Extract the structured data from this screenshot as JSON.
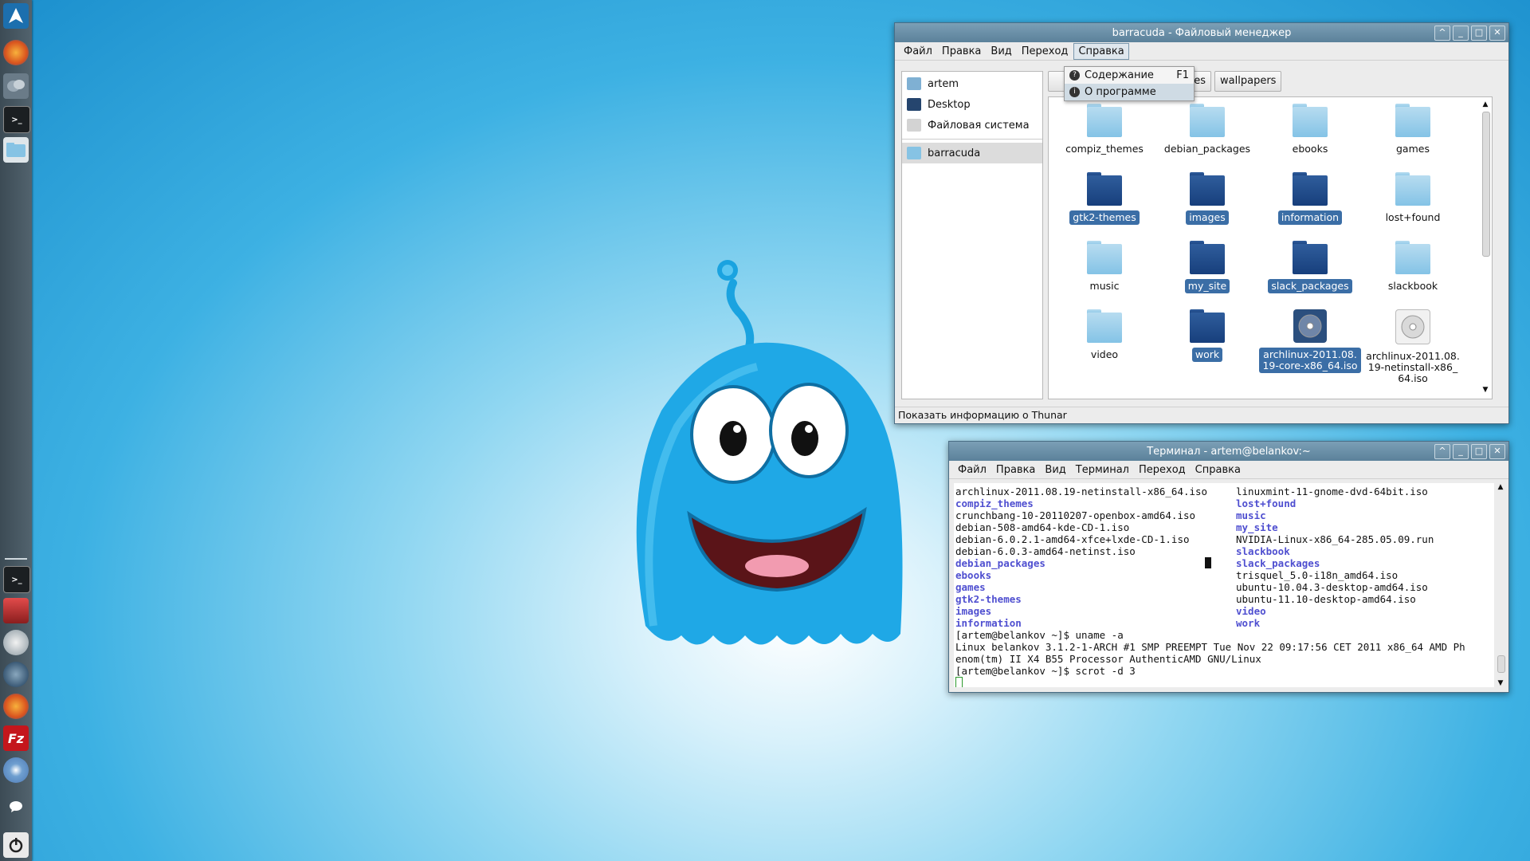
{
  "desktop": {
    "dock_items": [
      "arch-logo-icon",
      "firefox-icon",
      "pidgin-icon",
      "terminal-icon",
      "file-manager-icon",
      "terminal-icon-2",
      "image-viewer-icon",
      "disk-icon",
      "media-player-icon",
      "firefox-icon-2",
      "filezilla-icon",
      "chromium-icon",
      "chat-icon",
      "power-icon"
    ],
    "filezilla_glyph": "Fz"
  },
  "file_manager": {
    "title": "barracuda - Файловый менеджер",
    "menu": [
      "Файл",
      "Правка",
      "Вид",
      "Переход",
      "Справка"
    ],
    "help_menu": [
      {
        "label": "Содержание",
        "shortcut": "F1"
      },
      {
        "label": "О программе",
        "shortcut": ""
      }
    ],
    "sidebar": [
      {
        "label": "artem",
        "icon": "home-icon"
      },
      {
        "label": "Desktop",
        "icon": "desktop-icon"
      },
      {
        "label": "Файловая система",
        "icon": "drive-icon"
      },
      {
        "label": "barracuda",
        "icon": "folder-icon"
      }
    ],
    "path_buttons": [
      "ges",
      "wallpapers"
    ],
    "items": [
      {
        "name": "compiz_themes",
        "type": "folder",
        "selected": false
      },
      {
        "name": "debian_packages",
        "type": "folder",
        "selected": false
      },
      {
        "name": "ebooks",
        "type": "folder",
        "selected": false
      },
      {
        "name": "games",
        "type": "folder",
        "selected": false
      },
      {
        "name": "gtk2-themes",
        "type": "folder",
        "selected": true
      },
      {
        "name": "images",
        "type": "folder",
        "selected": true
      },
      {
        "name": "information",
        "type": "folder",
        "selected": true
      },
      {
        "name": "lost+found",
        "type": "folder",
        "selected": false
      },
      {
        "name": "music",
        "type": "folder",
        "selected": false
      },
      {
        "name": "my_site",
        "type": "folder",
        "selected": true
      },
      {
        "name": "slack_packages",
        "type": "folder",
        "selected": true
      },
      {
        "name": "slackbook",
        "type": "folder",
        "selected": false
      },
      {
        "name": "video",
        "type": "folder",
        "selected": false
      },
      {
        "name": "work",
        "type": "folder",
        "selected": true
      },
      {
        "name": "archlinux-2011.08.19-core-x86_64.iso",
        "type": "iso",
        "selected": true
      },
      {
        "name": "archlinux-2011.08.19-netinstall-x86_64.iso",
        "type": "iso",
        "selected": false
      }
    ],
    "status": "Показать информацию о Thunar"
  },
  "terminal": {
    "title": "Терминал - artem@belankov:~",
    "menu": [
      "Файл",
      "Правка",
      "Вид",
      "Терминал",
      "Переход",
      "Справка"
    ],
    "left_column": [
      {
        "text": "archlinux-2011.08.19-netinstall-x86_64.iso",
        "dir": false
      },
      {
        "text": "compiz_themes",
        "dir": true
      },
      {
        "text": "crunchbang-10-20110207-openbox-amd64.iso",
        "dir": false
      },
      {
        "text": "debian-508-amd64-kde-CD-1.iso",
        "dir": false
      },
      {
        "text": "debian-6.0.2.1-amd64-xfce+lxde-CD-1.iso",
        "dir": false
      },
      {
        "text": "debian-6.0.3-amd64-netinst.iso",
        "dir": false
      },
      {
        "text": "debian_packages",
        "dir": true
      },
      {
        "text": "ebooks",
        "dir": true
      },
      {
        "text": "games",
        "dir": true
      },
      {
        "text": "gtk2-themes",
        "dir": true
      },
      {
        "text": "images",
        "dir": true
      },
      {
        "text": "information",
        "dir": true
      }
    ],
    "right_column": [
      {
        "text": "linuxmint-11-gnome-dvd-64bit.iso",
        "dir": false
      },
      {
        "text": "lost+found",
        "dir": true
      },
      {
        "text": "music",
        "dir": true
      },
      {
        "text": "my_site",
        "dir": true
      },
      {
        "text": "NVIDIA-Linux-x86_64-285.05.09.run",
        "dir": false
      },
      {
        "text": "slackbook",
        "dir": true
      },
      {
        "text": "slack_packages",
        "dir": true
      },
      {
        "text": "trisquel_5.0-i18n_amd64.iso",
        "dir": false
      },
      {
        "text": "ubuntu-10.04.3-desktop-amd64.iso",
        "dir": false
      },
      {
        "text": "ubuntu-11.10-desktop-amd64.iso",
        "dir": false
      },
      {
        "text": "video",
        "dir": true
      },
      {
        "text": "work",
        "dir": true
      }
    ],
    "tail": [
      "[artem@belankov ~]$ uname -a",
      "Linux belankov 3.1.2-1-ARCH #1 SMP PREEMPT Tue Nov 22 09:17:56 CET 2011 x86_64 AMD Ph",
      "enom(tm) II X4 B55 Processor AuthenticAMD GNU/Linux",
      "[artem@belankov ~]$ scrot -d 3"
    ]
  },
  "colors": {
    "selection": "#3b6ea6",
    "dir_text": "#4f4fd0",
    "titlebar": "#5b819a"
  }
}
